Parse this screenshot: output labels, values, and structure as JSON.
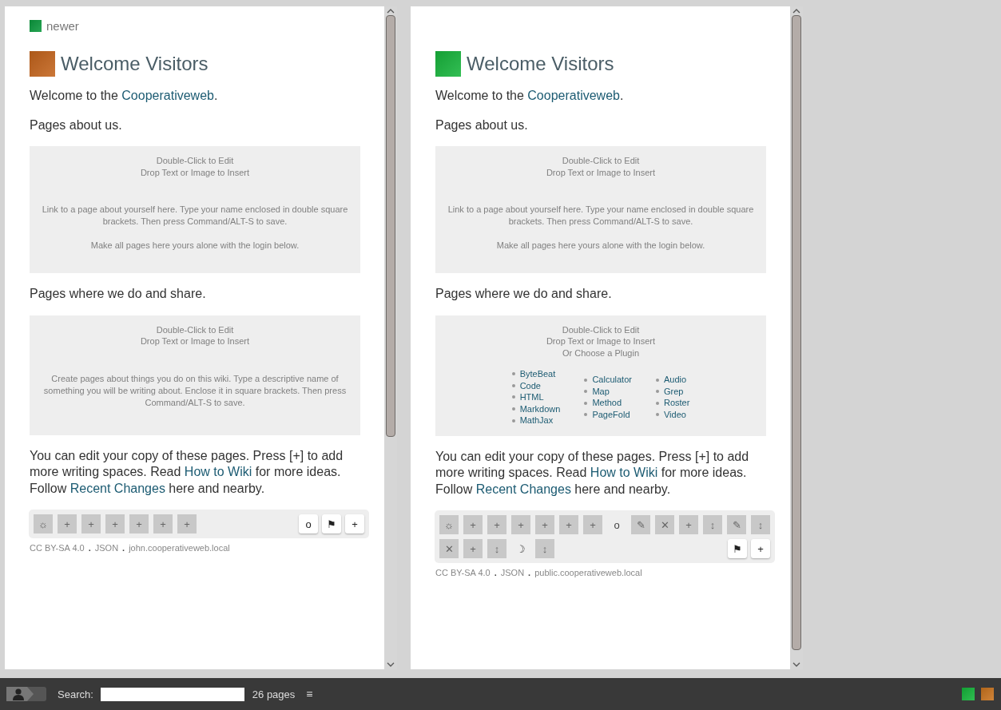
{
  "panels": [
    {
      "newer": {
        "label": "newer",
        "color": "#0b9a3e"
      },
      "title": "Welcome Visitors",
      "flag": {
        "color": "#c4641c"
      },
      "story": [
        {
          "kind": "paragraph",
          "parts": [
            {
              "text": "Welcome to the ",
              "kind": "text"
            },
            {
              "text": "Cooperativeweb",
              "kind": "link"
            },
            {
              "text": ".",
              "kind": "text"
            }
          ]
        },
        {
          "kind": "paragraph",
          "parts": [
            {
              "text": "Pages about us.",
              "kind": "text"
            }
          ]
        },
        {
          "kind": "factory",
          "hints": [
            "Double-Click to Edit",
            "Drop Text or Image to Insert"
          ],
          "notes": [
            "Link to a page about yourself here. Type your name enclosed in double square brackets. Then press Command/ALT-S to save.",
            "Make all pages here yours alone with the login below."
          ]
        },
        {
          "kind": "paragraph",
          "parts": [
            {
              "text": "Pages where we do and share.",
              "kind": "text"
            }
          ]
        },
        {
          "kind": "factory",
          "hints": [
            "Double-Click to Edit",
            "Drop Text or Image to Insert"
          ],
          "notes": [
            "Create pages about things you do on this wiki. Type a descriptive name of something you will be writing about. Enclose it in square brackets. Then press Command/ALT-S to save."
          ]
        },
        {
          "kind": "paragraph",
          "parts": [
            {
              "text": "You can edit your copy of these pages. Press [+] to add more writing spaces. Read ",
              "kind": "text"
            },
            {
              "text": "How to Wiki",
              "kind": "link"
            },
            {
              "text": " for more ideas. Follow ",
              "kind": "text"
            },
            {
              "text": "Recent Changes",
              "kind": "link"
            },
            {
              "text": " here and nearby.",
              "kind": "text"
            }
          ]
        }
      ],
      "journal": [
        {
          "symbol": "☼",
          "kind": "action"
        },
        {
          "symbol": "+",
          "kind": "action"
        },
        {
          "symbol": "+",
          "kind": "action"
        },
        {
          "symbol": "+",
          "kind": "action"
        },
        {
          "symbol": "+",
          "kind": "action"
        },
        {
          "symbol": "+",
          "kind": "action"
        },
        {
          "symbol": "+",
          "kind": "action"
        }
      ],
      "controls": [
        "o",
        "⚑",
        "+"
      ],
      "footer": [
        {
          "text": "CC BY-SA 4.0",
          "kind": "link"
        },
        {
          "text": ".",
          "kind": "separator"
        },
        {
          "text": "JSON",
          "kind": "link"
        },
        {
          "text": ".",
          "kind": "separator"
        },
        {
          "text": "john.cooperativeweb.local",
          "kind": "link"
        }
      ]
    },
    {
      "title": "Welcome Visitors",
      "flag": {
        "color": "#17b53c"
      },
      "story": [
        {
          "kind": "paragraph",
          "parts": [
            {
              "text": "Welcome to the ",
              "kind": "text"
            },
            {
              "text": "Cooperativeweb",
              "kind": "link"
            },
            {
              "text": ".",
              "kind": "text"
            }
          ]
        },
        {
          "kind": "paragraph",
          "parts": [
            {
              "text": "Pages about us.",
              "kind": "text"
            }
          ]
        },
        {
          "kind": "factory",
          "hints": [
            "Double-Click to Edit",
            "Drop Text or Image to Insert"
          ],
          "notes": [
            "Link to a page about yourself here. Type your name enclosed in double square brackets. Then press Command/ALT-S to save.",
            "Make all pages here yours alone with the login below."
          ]
        },
        {
          "kind": "paragraph",
          "parts": [
            {
              "text": "Pages where we do and share.",
              "kind": "text"
            }
          ]
        },
        {
          "kind": "factory",
          "hints": [
            "Double-Click to Edit",
            "Drop Text or Image to Insert",
            "Or Choose a Plugin"
          ],
          "plugin_columns": [
            [
              "ByteBeat",
              "Code",
              "HTML",
              "Markdown",
              "MathJax"
            ],
            [
              "Calculator",
              "Map",
              "Method",
              "PageFold"
            ],
            [
              "Audio",
              "Grep",
              "Roster",
              "Video"
            ]
          ]
        },
        {
          "kind": "paragraph",
          "parts": [
            {
              "text": "You can edit your copy of these pages. Press [+] to add more writing spaces. Read ",
              "kind": "text"
            },
            {
              "text": "How to Wiki",
              "kind": "link"
            },
            {
              "text": " for more ideas. Follow ",
              "kind": "text"
            },
            {
              "text": "Recent Changes",
              "kind": "link"
            },
            {
              "text": " here and nearby.",
              "kind": "text"
            }
          ]
        }
      ],
      "journal": [
        {
          "symbol": "☼",
          "kind": "action"
        },
        {
          "symbol": "+",
          "kind": "action"
        },
        {
          "symbol": "+",
          "kind": "action"
        },
        {
          "symbol": "+",
          "kind": "action"
        },
        {
          "symbol": "+",
          "kind": "action"
        },
        {
          "symbol": "+",
          "kind": "action"
        },
        {
          "symbol": "+",
          "kind": "action"
        },
        {
          "symbol": "o",
          "kind": "plain"
        },
        {
          "symbol": "✎",
          "kind": "action"
        },
        {
          "symbol": "✕",
          "kind": "action"
        },
        {
          "symbol": "+",
          "kind": "action"
        },
        {
          "symbol": "↕",
          "kind": "action"
        },
        {
          "symbol": "✎",
          "kind": "action"
        },
        {
          "symbol": "↕",
          "kind": "action"
        },
        {
          "symbol": "✕",
          "kind": "action"
        },
        {
          "symbol": "+",
          "kind": "action"
        },
        {
          "symbol": "↕",
          "kind": "action"
        },
        {
          "symbol": "☽",
          "kind": "plain"
        },
        {
          "symbol": "↕",
          "kind": "action"
        }
      ],
      "controls": [
        "⚑",
        "+"
      ],
      "footer": [
        {
          "text": "CC BY-SA 4.0",
          "kind": "link"
        },
        {
          "text": ".",
          "kind": "separator"
        },
        {
          "text": "JSON",
          "kind": "link"
        },
        {
          "text": ".",
          "kind": "separator"
        },
        {
          "text": "public.cooperativeweb.local",
          "kind": "link"
        }
      ]
    }
  ],
  "bottom_bar": {
    "search_label": "Search:",
    "page_count": "26 pages",
    "menu": "≡",
    "neighbors": [
      {
        "color": "#14b53a"
      },
      {
        "color": "#c9731e"
      }
    ]
  }
}
